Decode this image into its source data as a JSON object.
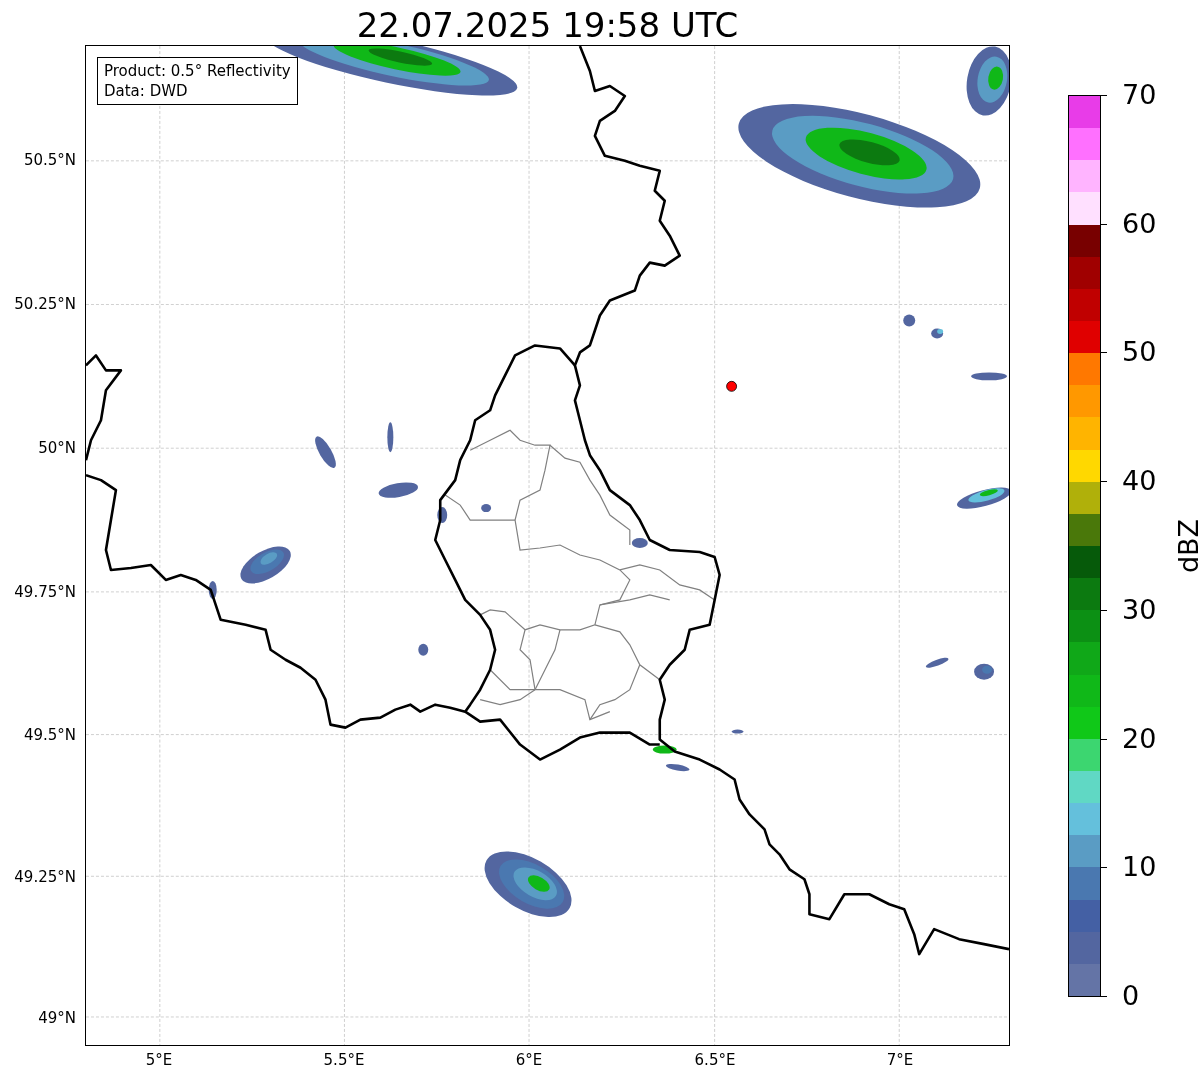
{
  "title": "22.07.2025 19:58 UTC",
  "legend": {
    "lines": [
      "Product: 0.5° Reflectivity",
      "Data: DWD"
    ]
  },
  "y_ticks": [
    "50.5°N",
    "50.25°N",
    "50°N",
    "49.75°N",
    "49.5°N",
    "49.25°N",
    "49°N"
  ],
  "x_ticks": [
    "5°E",
    "5.5°E",
    "6°E",
    "6.5°E",
    "7°E"
  ],
  "colorbar": {
    "label": "dBZ",
    "ticks": [
      "70",
      "60",
      "50",
      "40",
      "30",
      "20",
      "10",
      "0"
    ],
    "segments": [
      {
        "color": "#e83ce8"
      },
      {
        "color": "#ff70ff"
      },
      {
        "color": "#ffb4ff"
      },
      {
        "color": "#ffe0ff"
      },
      {
        "color": "#780000"
      },
      {
        "color": "#a00000"
      },
      {
        "color": "#c00000"
      },
      {
        "color": "#e00000"
      },
      {
        "color": "#ff7800"
      },
      {
        "color": "#ff9800"
      },
      {
        "color": "#ffb400"
      },
      {
        "color": "#ffd800"
      },
      {
        "color": "#b0b00a"
      },
      {
        "color": "#4a780a"
      },
      {
        "color": "#065a0a"
      },
      {
        "color": "#0c7a10"
      },
      {
        "color": "#0c9014"
      },
      {
        "color": "#10a818"
      },
      {
        "color": "#10b818"
      },
      {
        "color": "#10c818"
      },
      {
        "color": "#3cd670"
      },
      {
        "color": "#60d8c4"
      },
      {
        "color": "#64c0dc"
      },
      {
        "color": "#5a9cc4"
      },
      {
        "color": "#4a78b0"
      },
      {
        "color": "#4460a4"
      },
      {
        "color": "#5366a0"
      },
      {
        "color": "#6474a6"
      }
    ]
  }
}
